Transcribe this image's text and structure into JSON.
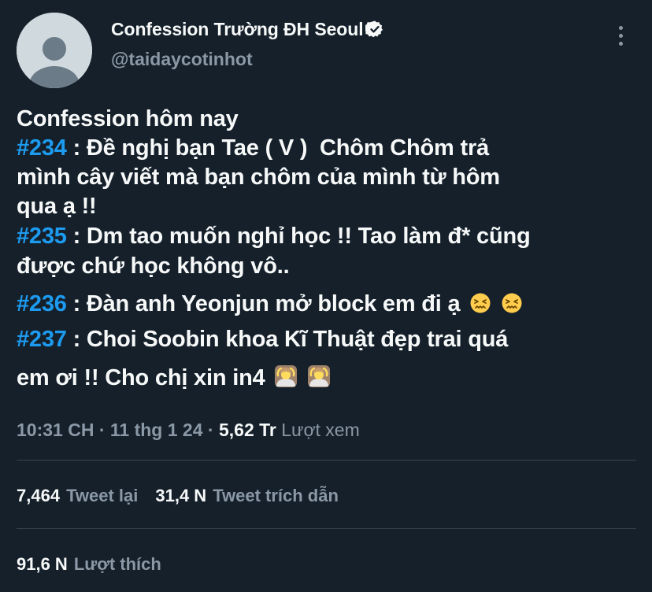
{
  "header": {
    "display_name": "Confession Trường ĐH Seoul",
    "handle": "@taidaycotinhot",
    "verified_icon": "verified-badge-icon",
    "more_icon": "more-options-icon"
  },
  "tweet": {
    "lines": [
      {
        "hashtag": "",
        "text": "Confession hôm nay"
      },
      {
        "hashtag": "#234",
        "text": " : Đề nghị bạn Tae ( V )  Chôm Chôm trả"
      },
      {
        "hashtag": "",
        "text": "mình cây viết mà bạn chôm của mình từ hôm"
      },
      {
        "hashtag": "",
        "text": "qua ạ !!"
      },
      {
        "hashtag": "#235",
        "text": " : Dm tao muốn nghỉ học !! Tao làm đ* cũng"
      },
      {
        "hashtag": "",
        "text": "được chứ học không vô.."
      },
      {
        "hashtag": "#236",
        "text": " : Đàn anh Yeonjun mở block em đi ạ"
      },
      {
        "hashtag": "#237",
        "text": " : Choi Soobin khoa Kĩ Thuật đẹp trai quá"
      },
      {
        "hashtag": "",
        "text": "em ơi !! Cho chị xin in4"
      }
    ],
    "emojis": {
      "line7": [
        "confounded-face-emoji",
        "confounded-face-emoji"
      ],
      "line9": [
        "person-gesturing-ok-emoji",
        "person-gesturing-ok-emoji"
      ]
    }
  },
  "meta": {
    "time": "10:31 CH",
    "separator1": " · ",
    "date": "11 thg 1 24",
    "separator2": " · ",
    "views_count": "5,62 Tr",
    "views_label": " Lượt xem"
  },
  "stats": {
    "retweets_count": "7,464",
    "retweets_label": "Tweet lại",
    "quotes_count": "31,4 N",
    "quotes_label": "Tweet trích dẫn",
    "likes_count": "91,6 N",
    "likes_label": "Lượt thích"
  },
  "colors": {
    "background": "#15202b",
    "hashtag": "#1d9bf0",
    "secondary_text": "#8b98a5",
    "divider": "#38444d"
  }
}
